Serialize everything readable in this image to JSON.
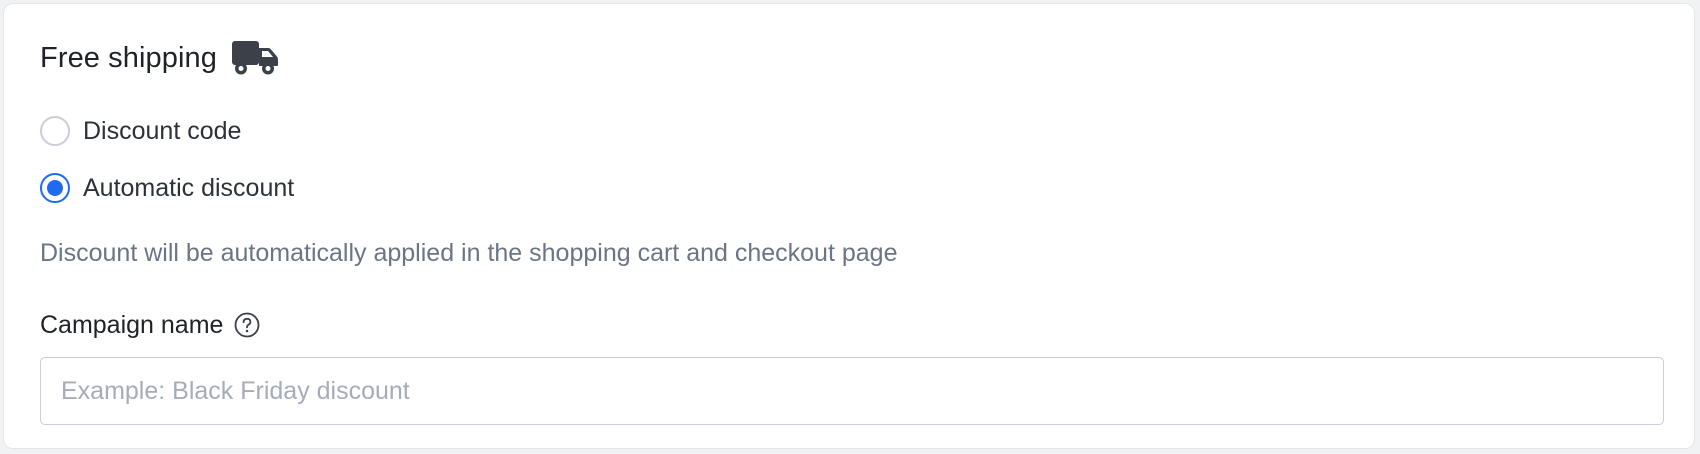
{
  "section": {
    "title": "Free shipping",
    "title_icon": "truck-icon"
  },
  "discount_type": {
    "options": [
      {
        "label": "Discount code",
        "selected": false
      },
      {
        "label": "Automatic discount",
        "selected": true
      }
    ],
    "help_text": "Discount will be automatically applied in the shopping cart and checkout page"
  },
  "campaign": {
    "label": "Campaign name",
    "help_icon": "question-circle-icon",
    "value": "",
    "placeholder": "Example: Black Friday discount"
  },
  "colors": {
    "accent": "#1f6bf0",
    "text": "#1f2328",
    "muted": "#6b7585",
    "border": "#c9ced8"
  }
}
